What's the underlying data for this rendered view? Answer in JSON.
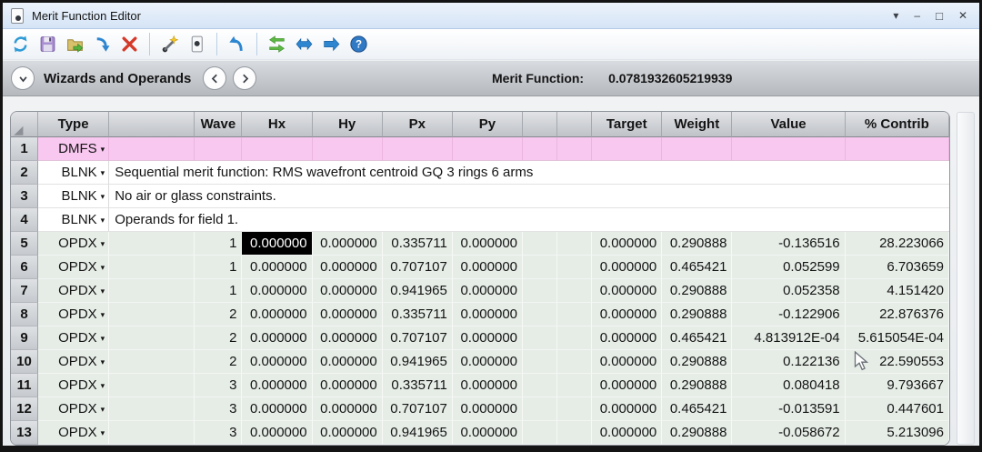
{
  "window": {
    "title": "Merit Function Editor"
  },
  "icons": {
    "menu_caret": "▾",
    "minimize": "–",
    "maximize": "□",
    "close": "✕",
    "type_caret": "▾",
    "corner_triangle": "◢",
    "help_glyph": "?"
  },
  "toolbar": {
    "icons": [
      "update-icon",
      "save-icon",
      "open-icon",
      "insert-operand-icon",
      "delete-operand-icon",
      "wizard-icon",
      "properties-icon",
      "undo-icon",
      "swap-icon",
      "resize-columns-icon",
      "go-icon",
      "help-icon"
    ]
  },
  "panel_bar": {
    "label": "Wizards and Operands",
    "merit_label": "Merit Function:",
    "merit_value": "0.0781932605219939"
  },
  "table": {
    "columns": [
      "",
      "Type",
      "",
      "Wave",
      "Hx",
      "Hy",
      "Px",
      "Py",
      "",
      "",
      "Target",
      "Weight",
      "Value",
      "% Contrib"
    ],
    "rows": [
      {
        "num": "1",
        "type": "DMFS",
        "kind": "dmfs"
      },
      {
        "num": "2",
        "type": "BLNK",
        "kind": "comment",
        "comment": "Sequential merit function: RMS wavefront centroid GQ 3 rings 6 arms"
      },
      {
        "num": "3",
        "type": "BLNK",
        "kind": "comment",
        "comment": "No air or glass constraints."
      },
      {
        "num": "4",
        "type": "BLNK",
        "kind": "comment",
        "comment": "Operands for field 1."
      },
      {
        "num": "5",
        "type": "OPDX",
        "kind": "operand",
        "wave": "1",
        "hx": "0.000000",
        "hy": "0.000000",
        "px": "0.335711",
        "py": "0.000000",
        "target": "0.000000",
        "weight": "0.290888",
        "value": "-0.136516",
        "contrib": "28.223066",
        "selected_cell": "hx"
      },
      {
        "num": "6",
        "type": "OPDX",
        "kind": "operand",
        "wave": "1",
        "hx": "0.000000",
        "hy": "0.000000",
        "px": "0.707107",
        "py": "0.000000",
        "target": "0.000000",
        "weight": "0.465421",
        "value": "0.052599",
        "contrib": "6.703659"
      },
      {
        "num": "7",
        "type": "OPDX",
        "kind": "operand",
        "wave": "1",
        "hx": "0.000000",
        "hy": "0.000000",
        "px": "0.941965",
        "py": "0.000000",
        "target": "0.000000",
        "weight": "0.290888",
        "value": "0.052358",
        "contrib": "4.151420"
      },
      {
        "num": "8",
        "type": "OPDX",
        "kind": "operand",
        "wave": "2",
        "hx": "0.000000",
        "hy": "0.000000",
        "px": "0.335711",
        "py": "0.000000",
        "target": "0.000000",
        "weight": "0.290888",
        "value": "-0.122906",
        "contrib": "22.876376"
      },
      {
        "num": "9",
        "type": "OPDX",
        "kind": "operand",
        "wave": "2",
        "hx": "0.000000",
        "hy": "0.000000",
        "px": "0.707107",
        "py": "0.000000",
        "target": "0.000000",
        "weight": "0.465421",
        "value": "4.813912E-04",
        "contrib": "5.615054E-04"
      },
      {
        "num": "10",
        "type": "OPDX",
        "kind": "operand",
        "wave": "2",
        "hx": "0.000000",
        "hy": "0.000000",
        "px": "0.941965",
        "py": "0.000000",
        "target": "0.000000",
        "weight": "0.290888",
        "value": "0.122136",
        "contrib": "22.590553"
      },
      {
        "num": "11",
        "type": "OPDX",
        "kind": "operand",
        "wave": "3",
        "hx": "0.000000",
        "hy": "0.000000",
        "px": "0.335711",
        "py": "0.000000",
        "target": "0.000000",
        "weight": "0.290888",
        "value": "0.080418",
        "contrib": "9.793667"
      },
      {
        "num": "12",
        "type": "OPDX",
        "kind": "operand",
        "wave": "3",
        "hx": "0.000000",
        "hy": "0.000000",
        "px": "0.707107",
        "py": "0.000000",
        "target": "0.000000",
        "weight": "0.465421",
        "value": "-0.013591",
        "contrib": "0.447601"
      },
      {
        "num": "13",
        "type": "OPDX",
        "kind": "operand",
        "wave": "3",
        "hx": "0.000000",
        "hy": "0.000000",
        "px": "0.941965",
        "py": "0.000000",
        "target": "0.000000",
        "weight": "0.290888",
        "value": "-0.058672",
        "contrib": "5.213096"
      }
    ]
  },
  "colors": {
    "titlebar": "#dce9f8",
    "highlight_row": "#f9c8f0",
    "operand_row": "#e6ede7",
    "selection_bg": "#000000",
    "selection_text": "#ffffff"
  }
}
